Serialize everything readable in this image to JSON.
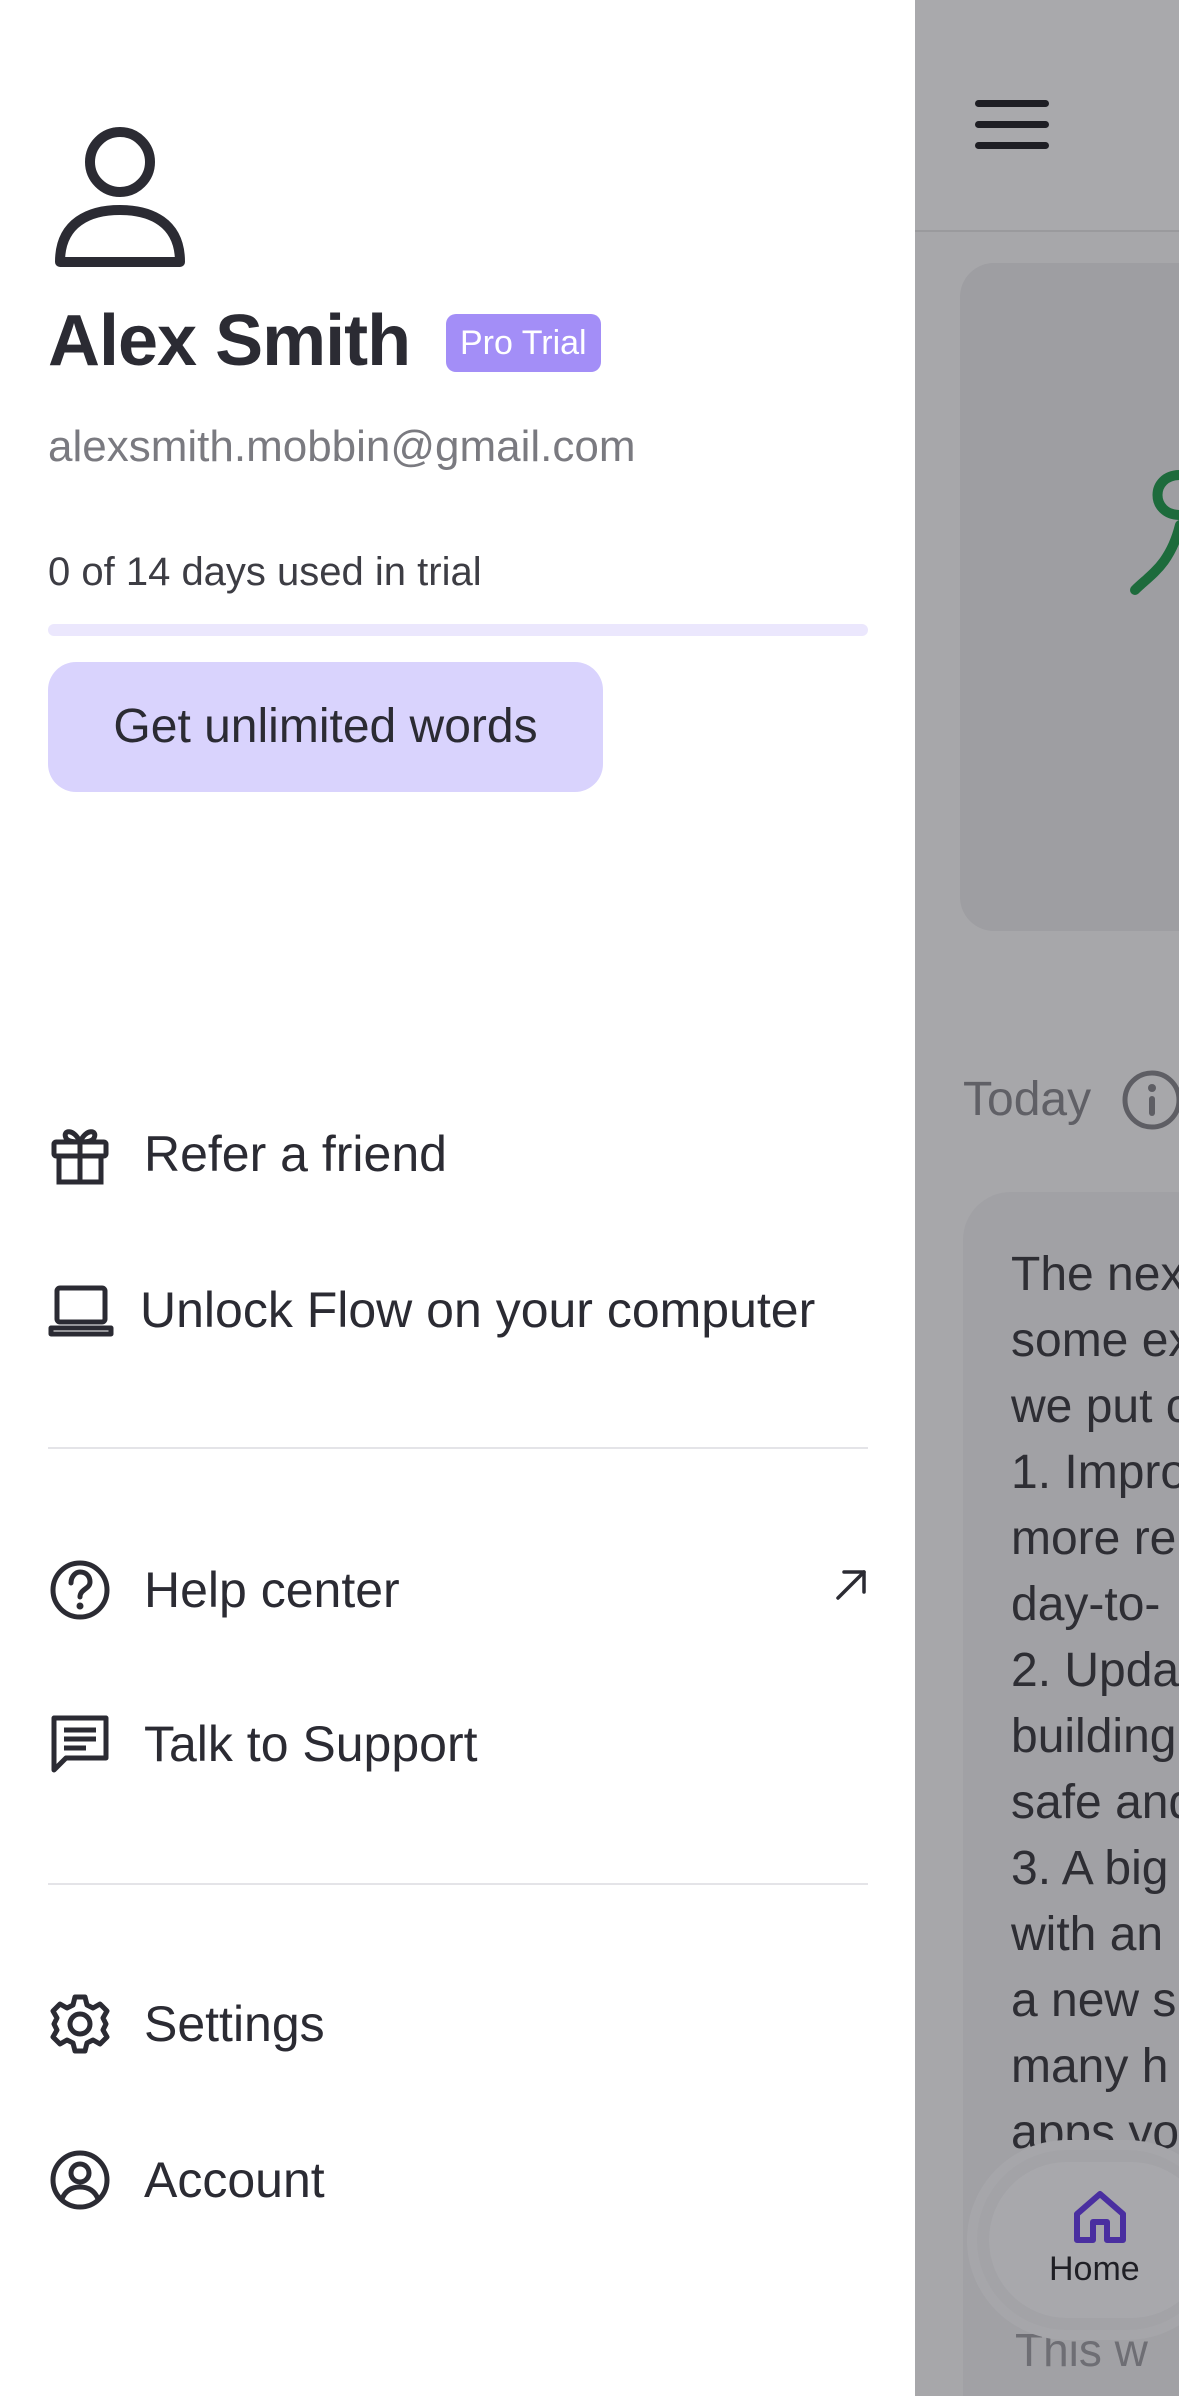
{
  "profile": {
    "name": "Alex Smith",
    "badge": "Pro Trial",
    "email": "alexsmith.mobbin@gmail.com",
    "trial_text": "0 of 14 days used in trial",
    "trial_progress_fraction": 0,
    "cta_label": "Get unlimited words"
  },
  "menu": {
    "refer": "Refer a friend",
    "unlock": "Unlock Flow on your computer",
    "help": "Help center",
    "support": "Talk to Support",
    "settings": "Settings",
    "account": "Account"
  },
  "background_app": {
    "today_label": "Today",
    "text_lines": [
      "The nex",
      "some ex",
      "we put c",
      "1. Impro",
      "more re",
      "day-to-",
      "2. Upda",
      "building",
      "safe and",
      "3. A big",
      "with an",
      "a new s",
      "many h",
      "apps yo"
    ],
    "bottom_text": "This w",
    "tab_home": "Home"
  },
  "colors": {
    "accent": "#a38ef7",
    "cta_bg": "#d9d3fd",
    "text": "#2b2b33",
    "muted": "#7a7a80",
    "overlay": "#a7a7aa"
  },
  "icons": [
    "user-avatar-icon",
    "gift-icon",
    "laptop-icon",
    "help-circle-icon",
    "external-arrow-icon",
    "message-icon",
    "gear-icon",
    "account-circle-icon",
    "menu-icon",
    "info-icon",
    "home-icon"
  ]
}
